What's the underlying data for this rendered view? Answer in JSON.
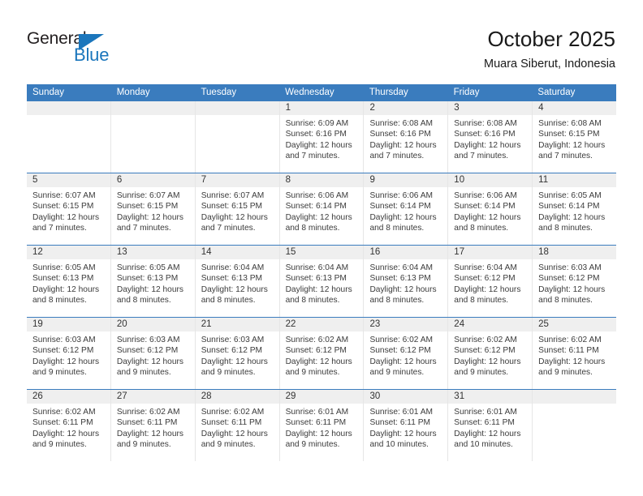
{
  "brand": {
    "name_primary": "General",
    "name_secondary": "Blue",
    "accent_color": "#1b76bc",
    "logo_icon": "triangle-flag-icon"
  },
  "header": {
    "title": "October 2025",
    "subtitle": "Muara Siberut, Indonesia"
  },
  "calendar": {
    "header_color": "#3a7cbe",
    "daynum_band_color": "#efefef",
    "weekdays": [
      "Sunday",
      "Monday",
      "Tuesday",
      "Wednesday",
      "Thursday",
      "Friday",
      "Saturday"
    ],
    "weeks": [
      [
        {
          "day": "",
          "empty": true,
          "sunrise": "",
          "sunset": "",
          "daylight1": "",
          "daylight2": ""
        },
        {
          "day": "",
          "empty": true,
          "sunrise": "",
          "sunset": "",
          "daylight1": "",
          "daylight2": ""
        },
        {
          "day": "",
          "empty": true,
          "sunrise": "",
          "sunset": "",
          "daylight1": "",
          "daylight2": ""
        },
        {
          "day": "1",
          "empty": false,
          "sunrise": "Sunrise: 6:09 AM",
          "sunset": "Sunset: 6:16 PM",
          "daylight1": "Daylight: 12 hours",
          "daylight2": "and 7 minutes."
        },
        {
          "day": "2",
          "empty": false,
          "sunrise": "Sunrise: 6:08 AM",
          "sunset": "Sunset: 6:16 PM",
          "daylight1": "Daylight: 12 hours",
          "daylight2": "and 7 minutes."
        },
        {
          "day": "3",
          "empty": false,
          "sunrise": "Sunrise: 6:08 AM",
          "sunset": "Sunset: 6:16 PM",
          "daylight1": "Daylight: 12 hours",
          "daylight2": "and 7 minutes."
        },
        {
          "day": "4",
          "empty": false,
          "sunrise": "Sunrise: 6:08 AM",
          "sunset": "Sunset: 6:15 PM",
          "daylight1": "Daylight: 12 hours",
          "daylight2": "and 7 minutes."
        }
      ],
      [
        {
          "day": "5",
          "empty": false,
          "sunrise": "Sunrise: 6:07 AM",
          "sunset": "Sunset: 6:15 PM",
          "daylight1": "Daylight: 12 hours",
          "daylight2": "and 7 minutes."
        },
        {
          "day": "6",
          "empty": false,
          "sunrise": "Sunrise: 6:07 AM",
          "sunset": "Sunset: 6:15 PM",
          "daylight1": "Daylight: 12 hours",
          "daylight2": "and 7 minutes."
        },
        {
          "day": "7",
          "empty": false,
          "sunrise": "Sunrise: 6:07 AM",
          "sunset": "Sunset: 6:15 PM",
          "daylight1": "Daylight: 12 hours",
          "daylight2": "and 7 minutes."
        },
        {
          "day": "8",
          "empty": false,
          "sunrise": "Sunrise: 6:06 AM",
          "sunset": "Sunset: 6:14 PM",
          "daylight1": "Daylight: 12 hours",
          "daylight2": "and 8 minutes."
        },
        {
          "day": "9",
          "empty": false,
          "sunrise": "Sunrise: 6:06 AM",
          "sunset": "Sunset: 6:14 PM",
          "daylight1": "Daylight: 12 hours",
          "daylight2": "and 8 minutes."
        },
        {
          "day": "10",
          "empty": false,
          "sunrise": "Sunrise: 6:06 AM",
          "sunset": "Sunset: 6:14 PM",
          "daylight1": "Daylight: 12 hours",
          "daylight2": "and 8 minutes."
        },
        {
          "day": "11",
          "empty": false,
          "sunrise": "Sunrise: 6:05 AM",
          "sunset": "Sunset: 6:14 PM",
          "daylight1": "Daylight: 12 hours",
          "daylight2": "and 8 minutes."
        }
      ],
      [
        {
          "day": "12",
          "empty": false,
          "sunrise": "Sunrise: 6:05 AM",
          "sunset": "Sunset: 6:13 PM",
          "daylight1": "Daylight: 12 hours",
          "daylight2": "and 8 minutes."
        },
        {
          "day": "13",
          "empty": false,
          "sunrise": "Sunrise: 6:05 AM",
          "sunset": "Sunset: 6:13 PM",
          "daylight1": "Daylight: 12 hours",
          "daylight2": "and 8 minutes."
        },
        {
          "day": "14",
          "empty": false,
          "sunrise": "Sunrise: 6:04 AM",
          "sunset": "Sunset: 6:13 PM",
          "daylight1": "Daylight: 12 hours",
          "daylight2": "and 8 minutes."
        },
        {
          "day": "15",
          "empty": false,
          "sunrise": "Sunrise: 6:04 AM",
          "sunset": "Sunset: 6:13 PM",
          "daylight1": "Daylight: 12 hours",
          "daylight2": "and 8 minutes."
        },
        {
          "day": "16",
          "empty": false,
          "sunrise": "Sunrise: 6:04 AM",
          "sunset": "Sunset: 6:13 PM",
          "daylight1": "Daylight: 12 hours",
          "daylight2": "and 8 minutes."
        },
        {
          "day": "17",
          "empty": false,
          "sunrise": "Sunrise: 6:04 AM",
          "sunset": "Sunset: 6:12 PM",
          "daylight1": "Daylight: 12 hours",
          "daylight2": "and 8 minutes."
        },
        {
          "day": "18",
          "empty": false,
          "sunrise": "Sunrise: 6:03 AM",
          "sunset": "Sunset: 6:12 PM",
          "daylight1": "Daylight: 12 hours",
          "daylight2": "and 8 minutes."
        }
      ],
      [
        {
          "day": "19",
          "empty": false,
          "sunrise": "Sunrise: 6:03 AM",
          "sunset": "Sunset: 6:12 PM",
          "daylight1": "Daylight: 12 hours",
          "daylight2": "and 9 minutes."
        },
        {
          "day": "20",
          "empty": false,
          "sunrise": "Sunrise: 6:03 AM",
          "sunset": "Sunset: 6:12 PM",
          "daylight1": "Daylight: 12 hours",
          "daylight2": "and 9 minutes."
        },
        {
          "day": "21",
          "empty": false,
          "sunrise": "Sunrise: 6:03 AM",
          "sunset": "Sunset: 6:12 PM",
          "daylight1": "Daylight: 12 hours",
          "daylight2": "and 9 minutes."
        },
        {
          "day": "22",
          "empty": false,
          "sunrise": "Sunrise: 6:02 AM",
          "sunset": "Sunset: 6:12 PM",
          "daylight1": "Daylight: 12 hours",
          "daylight2": "and 9 minutes."
        },
        {
          "day": "23",
          "empty": false,
          "sunrise": "Sunrise: 6:02 AM",
          "sunset": "Sunset: 6:12 PM",
          "daylight1": "Daylight: 12 hours",
          "daylight2": "and 9 minutes."
        },
        {
          "day": "24",
          "empty": false,
          "sunrise": "Sunrise: 6:02 AM",
          "sunset": "Sunset: 6:12 PM",
          "daylight1": "Daylight: 12 hours",
          "daylight2": "and 9 minutes."
        },
        {
          "day": "25",
          "empty": false,
          "sunrise": "Sunrise: 6:02 AM",
          "sunset": "Sunset: 6:11 PM",
          "daylight1": "Daylight: 12 hours",
          "daylight2": "and 9 minutes."
        }
      ],
      [
        {
          "day": "26",
          "empty": false,
          "sunrise": "Sunrise: 6:02 AM",
          "sunset": "Sunset: 6:11 PM",
          "daylight1": "Daylight: 12 hours",
          "daylight2": "and 9 minutes."
        },
        {
          "day": "27",
          "empty": false,
          "sunrise": "Sunrise: 6:02 AM",
          "sunset": "Sunset: 6:11 PM",
          "daylight1": "Daylight: 12 hours",
          "daylight2": "and 9 minutes."
        },
        {
          "day": "28",
          "empty": false,
          "sunrise": "Sunrise: 6:02 AM",
          "sunset": "Sunset: 6:11 PM",
          "daylight1": "Daylight: 12 hours",
          "daylight2": "and 9 minutes."
        },
        {
          "day": "29",
          "empty": false,
          "sunrise": "Sunrise: 6:01 AM",
          "sunset": "Sunset: 6:11 PM",
          "daylight1": "Daylight: 12 hours",
          "daylight2": "and 9 minutes."
        },
        {
          "day": "30",
          "empty": false,
          "sunrise": "Sunrise: 6:01 AM",
          "sunset": "Sunset: 6:11 PM",
          "daylight1": "Daylight: 12 hours",
          "daylight2": "and 10 minutes."
        },
        {
          "day": "31",
          "empty": false,
          "sunrise": "Sunrise: 6:01 AM",
          "sunset": "Sunset: 6:11 PM",
          "daylight1": "Daylight: 12 hours",
          "daylight2": "and 10 minutes."
        },
        {
          "day": "",
          "empty": true,
          "sunrise": "",
          "sunset": "",
          "daylight1": "",
          "daylight2": ""
        }
      ]
    ]
  }
}
